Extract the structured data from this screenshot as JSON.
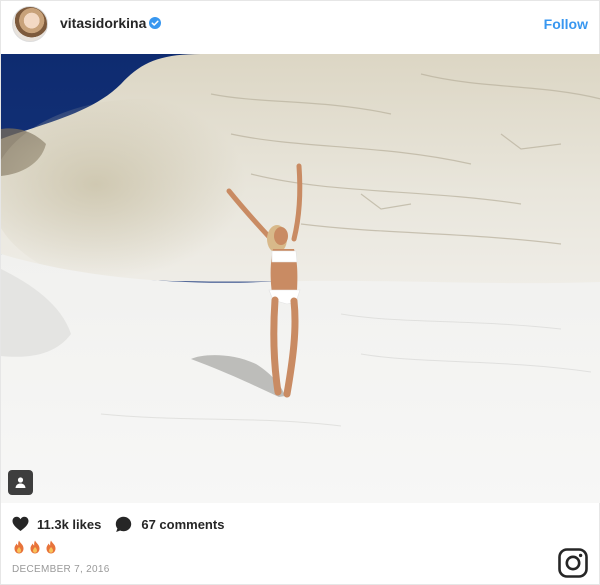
{
  "header": {
    "username": "vitasidorkina",
    "follow_label": "Follow",
    "avatar_icon": "profile-avatar",
    "verified_icon": "verified-badge-icon",
    "accent_color": "#3897f0"
  },
  "photo": {
    "tag_icon": "user-tag-icon"
  },
  "footer": {
    "likes_label": "11.3k likes",
    "comments_label": "67 comments",
    "heart_icon": "heart-icon",
    "comment_icon": "comment-bubble-icon",
    "emojis": [
      "fire-emoji",
      "fire-emoji",
      "fire-emoji"
    ],
    "date": "DECEMBER 7, 2016",
    "logo_icon": "instagram-icon"
  }
}
